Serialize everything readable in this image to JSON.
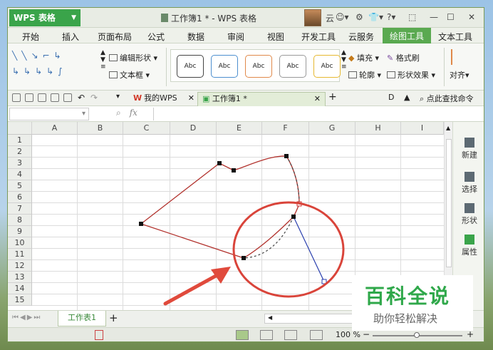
{
  "app": {
    "name": "WPS 表格",
    "doc_title": "工作簿1 * - WPS 表格",
    "user": "云"
  },
  "ribbon_tabs": [
    "开始",
    "插入",
    "页面布局",
    "公式",
    "数据",
    "审阅",
    "视图",
    "开发工具",
    "云服务",
    "绘图工具",
    "文本工具"
  ],
  "active_tab": "绘图工具",
  "ribbon": {
    "edit_shape": "编辑形状",
    "text_box": "文本框",
    "style_box": "Abc",
    "fill": "填充",
    "format_painter": "格式刷",
    "outline": "轮廓",
    "shape_effects": "形状效果",
    "align": "对齐"
  },
  "doc_tabs": [
    "我的WPS",
    "工作簿1 *"
  ],
  "search_cmd": "点此查找命令",
  "formula_bar": {
    "fx": "fx"
  },
  "columns": [
    "A",
    "B",
    "C",
    "D",
    "E",
    "F",
    "G",
    "H",
    "I"
  ],
  "rows": [
    "1",
    "2",
    "3",
    "4",
    "5",
    "6",
    "7",
    "8",
    "9",
    "10",
    "11",
    "12",
    "13",
    "14",
    "15"
  ],
  "side_panel": [
    "新建",
    "选择",
    "形状",
    "属性"
  ],
  "sheet_tab": "工作表1",
  "zoom": "100 %",
  "watermark": {
    "line1": "百科全说",
    "line2": "助你轻松解决"
  },
  "colors": {
    "accent": "#3aa44a",
    "shape_line": "#b2332e",
    "annotation": "#d9443a",
    "handle_line": "#2a3fae"
  }
}
